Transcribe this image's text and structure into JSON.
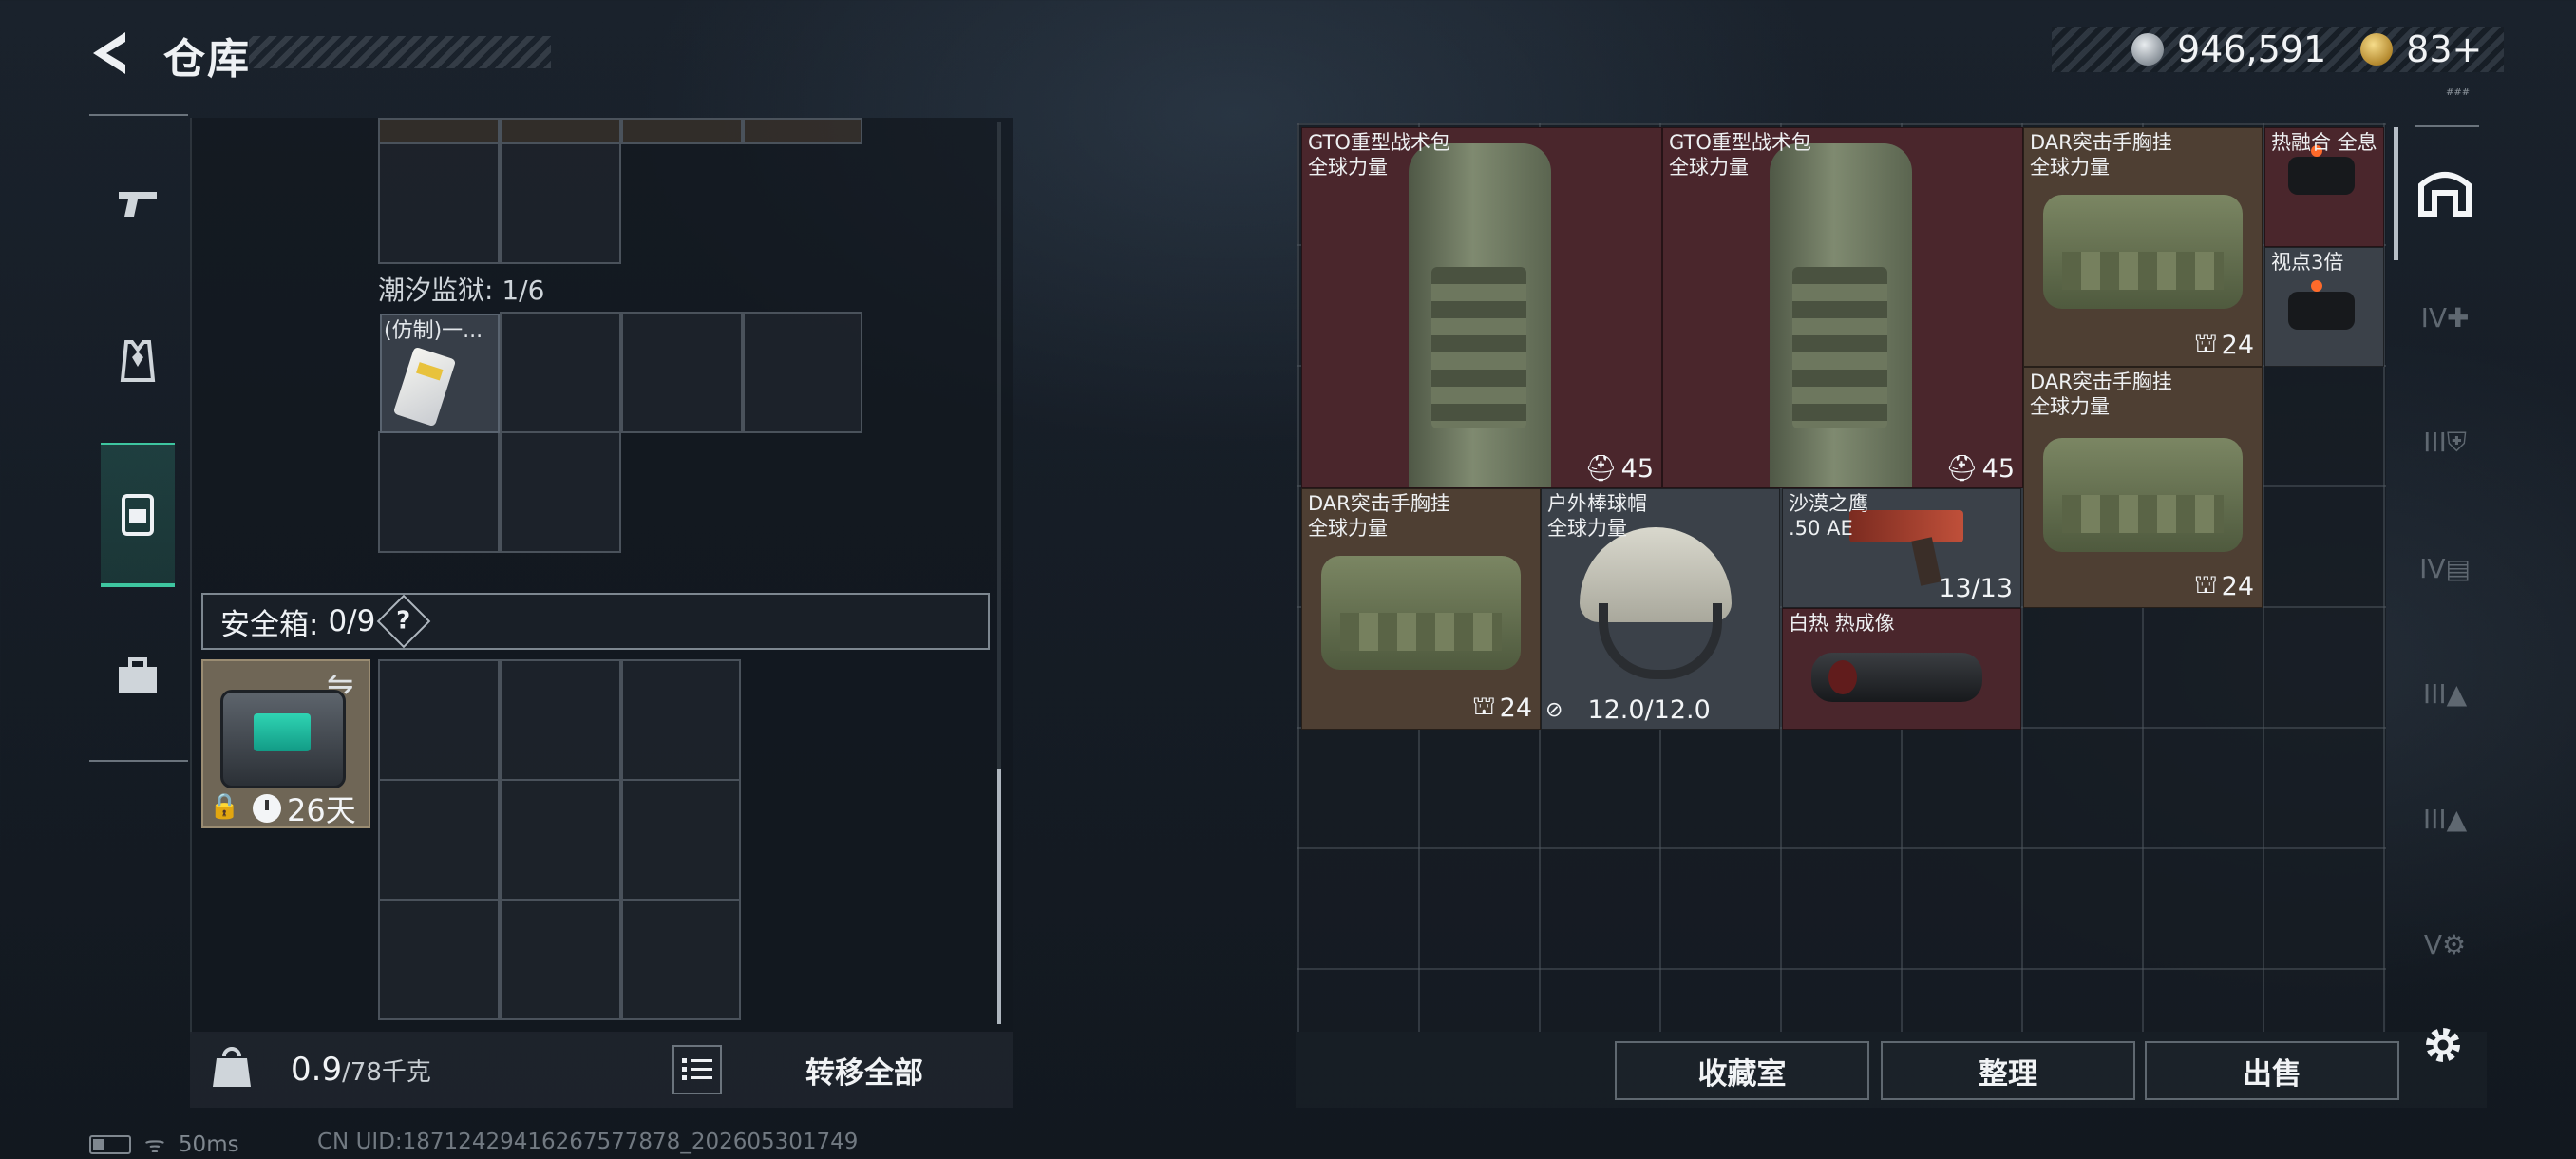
{
  "header": {
    "title": "仓库"
  },
  "currency": {
    "silver": "946,591",
    "gold": "83+"
  },
  "left_tabs": [
    {
      "name": "weapons"
    },
    {
      "name": "armor"
    },
    {
      "name": "backpack",
      "active": true
    },
    {
      "name": "case"
    }
  ],
  "inventory": {
    "section_label": "潮汐监狱: 1/6",
    "counterfeit_item_name": "(仿制)一...",
    "safe_label": "安全箱:",
    "safe_count": "0/9",
    "safe_help": "?",
    "safe_timer": "26天"
  },
  "weight": {
    "value": "0.9",
    "max": "/78千克"
  },
  "buttons": {
    "transfer_all": "转移全部",
    "collection": "收藏室",
    "organize": "整理",
    "sell": "出售"
  },
  "status": {
    "ping": "50ms",
    "uid": "CN UID:18712429416267577878_202605301749"
  },
  "warehouse_items": [
    {
      "name": "GTO重型战术包\n全球力量",
      "badge": "45",
      "color": "red"
    },
    {
      "name": "GTO重型战术包\n全球力量",
      "badge": "45",
      "color": "red"
    },
    {
      "name": "DAR突击手胸挂\n全球力量",
      "badge": "24",
      "color": "brown"
    },
    {
      "name": "热融合 全息",
      "badge": "",
      "color": "red"
    },
    {
      "name": "视点3倍",
      "badge": "",
      "color": "gray"
    },
    {
      "name": "DAR突击手胸挂\n全球力量",
      "badge": "24",
      "color": "brown"
    },
    {
      "name": "DAR突击手胸挂\n全球力量",
      "badge": "24",
      "color": "brown"
    },
    {
      "name": "户外棒球帽\n全球力量",
      "badge": "12.0/12.0",
      "color": "gray"
    },
    {
      "name": "沙漠之鹰\n.50 AE",
      "badge": "13/13",
      "color": "gray"
    },
    {
      "name": "白热 热成像",
      "badge": "",
      "color": "red"
    }
  ],
  "right_tabs": [
    "house",
    "IV medkit",
    "III armor",
    "IV folder",
    "III helmet",
    "III plate",
    "V backpack"
  ],
  "mini_label": "###"
}
